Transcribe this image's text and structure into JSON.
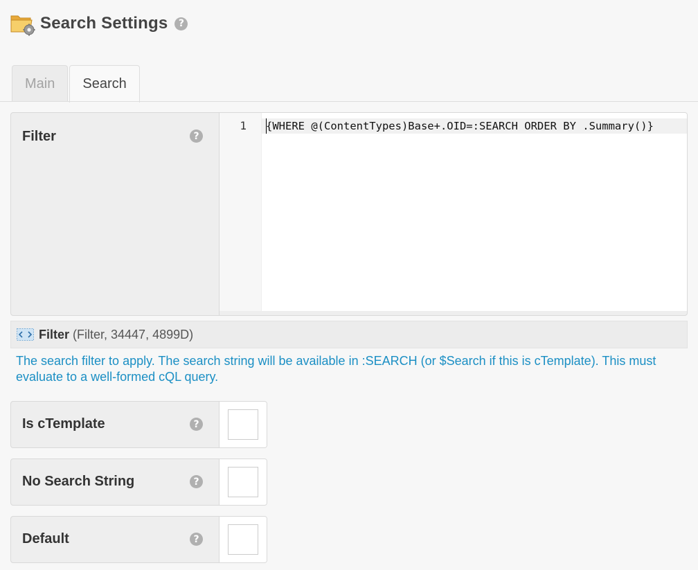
{
  "header": {
    "title": "Search Settings",
    "help": "?"
  },
  "tabs": [
    {
      "label": "Main",
      "active": false
    },
    {
      "label": "Search",
      "active": true
    }
  ],
  "filter": {
    "label": "Filter",
    "help": "?",
    "editor": {
      "line_number": "1",
      "code": "{WHERE @(ContentTypes)Base+.OID=:SEARCH ORDER BY .Summary()}"
    }
  },
  "info": {
    "icon": "code-brackets-icon",
    "name": "Filter",
    "meta": "(Filter, 34447, 4899D)"
  },
  "description": "The search filter to apply. The search string will be available in :SEARCH (or $Search if this is cTemplate). This must evaluate to a well-formed cQL query.",
  "checkboxes": [
    {
      "label": "Is cTemplate",
      "help": "?",
      "checked": false
    },
    {
      "label": "No Search String",
      "help": "?",
      "checked": false
    },
    {
      "label": "Default",
      "help": "?",
      "checked": false
    }
  ],
  "colors": {
    "accent_text": "#1b8fc4",
    "folder": "#f2c24f"
  }
}
